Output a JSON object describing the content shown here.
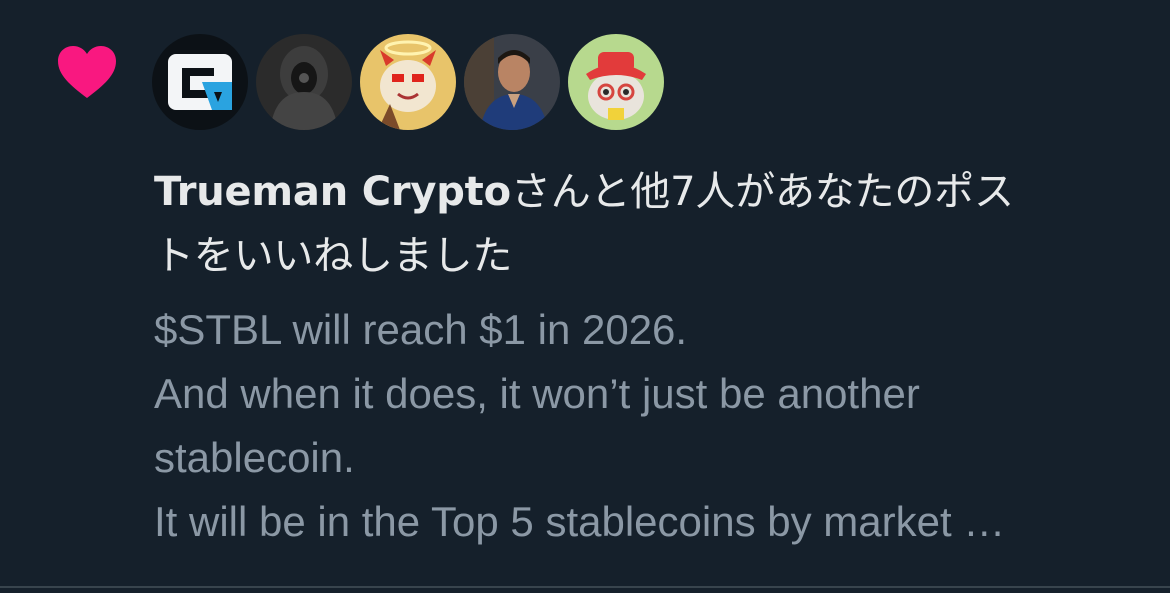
{
  "notification": {
    "type_icon": "heart-icon",
    "accent_color": "#f91880",
    "avatars": [
      {
        "name": "avatar-trueman-crypto",
        "icon": "logo-avatar"
      },
      {
        "name": "avatar-dark-hooded",
        "icon": "hooded-figure-avatar"
      },
      {
        "name": "avatar-red-cartoon",
        "icon": "cartoon-character-avatar"
      },
      {
        "name": "avatar-man-photo",
        "icon": "person-photo-avatar"
      },
      {
        "name": "avatar-cat-hat",
        "icon": "cat-with-hat-avatar"
      }
    ],
    "headline_user": "Trueman Crypto",
    "headline_rest_line1": "さんと他7人があなたのポス",
    "headline_rest_line2": "トをいいねしました",
    "preview_lines": [
      "$STBL will reach $1 in 2026.",
      "And when it does, it won’t just be another",
      "stablecoin.",
      "It will be in the Top 5 stablecoins by market …"
    ]
  }
}
